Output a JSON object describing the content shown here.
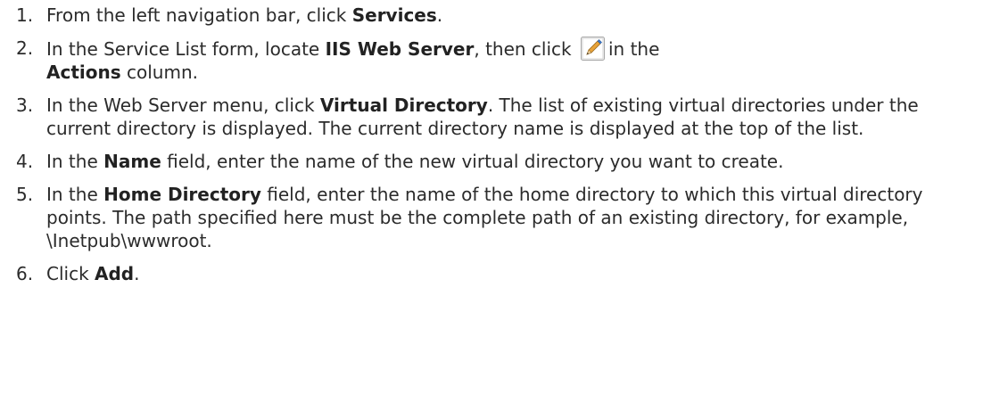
{
  "steps": [
    {
      "number": "1.",
      "parts": [
        "From the left navigation bar, click ",
        "Services",
        "."
      ]
    },
    {
      "number": "2.",
      "parts": [
        "In the Service List form, locate ",
        "IIS Web Server",
        ", then click ",
        "in the ",
        "Actions",
        " column."
      ],
      "icon": "edit-pencil-icon"
    },
    {
      "number": "3.",
      "parts": [
        "In the Web Server menu, click ",
        "Virtual Directory",
        ". The list of existing virtual directories under the current directory is displayed. The current directory name is displayed at the top of the list."
      ]
    },
    {
      "number": "4.",
      "parts": [
        "In the ",
        "Name",
        " field, enter the name of the new virtual directory you want to create."
      ]
    },
    {
      "number": "5.",
      "parts": [
        "In the ",
        "Home Directory",
        " field, enter the name of the home directory to which this virtual directory points. The path specified here must be the complete path of an existing directory, for example, \\Inetpub\\wwwroot."
      ]
    },
    {
      "number": "6.",
      "parts": [
        "Click ",
        "Add",
        "."
      ]
    }
  ],
  "colors": {
    "text": "#2b2b2b",
    "icon_border": "#a8a8a8",
    "icon_pencil": "#e8a33a",
    "icon_tip": "#3a7bd5"
  }
}
